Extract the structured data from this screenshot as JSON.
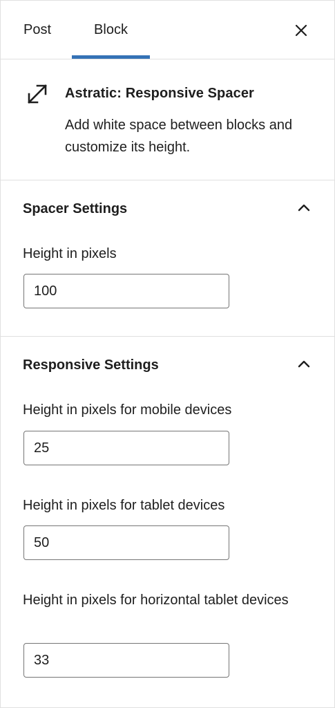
{
  "tabs": {
    "post_label": "Post",
    "block_label": "Block",
    "active": "Block"
  },
  "block": {
    "icon": "resize-diagonal-icon",
    "title": "Astratic: Responsive Spacer",
    "description": "Add white space between blocks and customize its height."
  },
  "spacer_settings": {
    "title": "Spacer Settings",
    "expanded": true,
    "height_label": "Height in pixels",
    "height_value": "100"
  },
  "responsive_settings": {
    "title": "Responsive Settings",
    "expanded": true,
    "mobile_label": "Height in pixels for mobile devices",
    "mobile_value": "25",
    "tablet_label": "Height in pixels for tablet devices",
    "tablet_value": "50",
    "horizontal_tablet_label": "Height in pixels for horizontal tablet devices",
    "horizontal_tablet_value": "33"
  },
  "colors": {
    "accent": "#3472b6",
    "border": "#e0e0e0",
    "text": "#1e1e1e"
  }
}
